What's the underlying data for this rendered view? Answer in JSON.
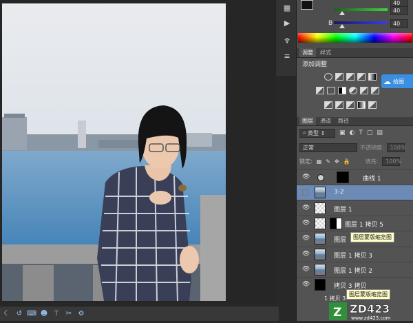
{
  "color_panel": {
    "sliders": [
      {
        "label": "",
        "value": "40",
        "track_from": "#1f5e1f",
        "track_to": "#3fd03f",
        "position": 0.16
      },
      {
        "label": "B",
        "value": "40",
        "track_from": "#1a1a5e",
        "track_to": "#3a3af0",
        "position": 0.16
      }
    ],
    "top_values": [
      "40"
    ]
  },
  "adjustments": {
    "tabs": [
      "调整",
      "样式"
    ],
    "title": "添加调整",
    "baidu_badge": "拾图"
  },
  "layers": {
    "tabs": [
      "图层",
      "通道",
      "路径"
    ],
    "filter_kind": "类型",
    "blend_mode": "正常",
    "opacity_label": "不透明度:",
    "opacity_value": "100%",
    "lock_label": "锁定:",
    "fill_label": "填充:",
    "fill_value": "100%",
    "rows": [
      {
        "name": "曲线 1",
        "selected": false,
        "visible": true,
        "thumb": "adjust",
        "mask": "black"
      },
      {
        "name": "3-2",
        "selected": true,
        "visible": false,
        "thumb": "photo",
        "mask": ""
      },
      {
        "name": "图层 1",
        "selected": false,
        "visible": true,
        "thumb": "checker",
        "mask": ""
      },
      {
        "name": "图层 1 拷贝 5",
        "selected": false,
        "visible": true,
        "thumb": "checker",
        "mask": "blackwhite"
      },
      {
        "name": "图层",
        "selected": false,
        "visible": true,
        "thumb": "photo",
        "mask": ""
      },
      {
        "name": "图层 1 拷贝 3",
        "selected": false,
        "visible": true,
        "thumb": "photo",
        "mask": ""
      },
      {
        "name": "图层 1 拷贝 2",
        "selected": false,
        "visible": true,
        "thumb": "photo",
        "mask": ""
      },
      {
        "name": "拷贝 3 拷贝",
        "selected": false,
        "visible": true,
        "thumb": "black",
        "mask": ""
      }
    ],
    "tooltips": [
      "图层蒙版缩览图",
      "图层蒙版缩览图"
    ],
    "bottom_item": "1 拷贝 3"
  },
  "watermark": {
    "brand": "ZD423",
    "site": "www.zd423.com"
  },
  "colors": {
    "selection": "#6b8ab6",
    "panel": "#535353",
    "badge": "#3a8fe0"
  }
}
